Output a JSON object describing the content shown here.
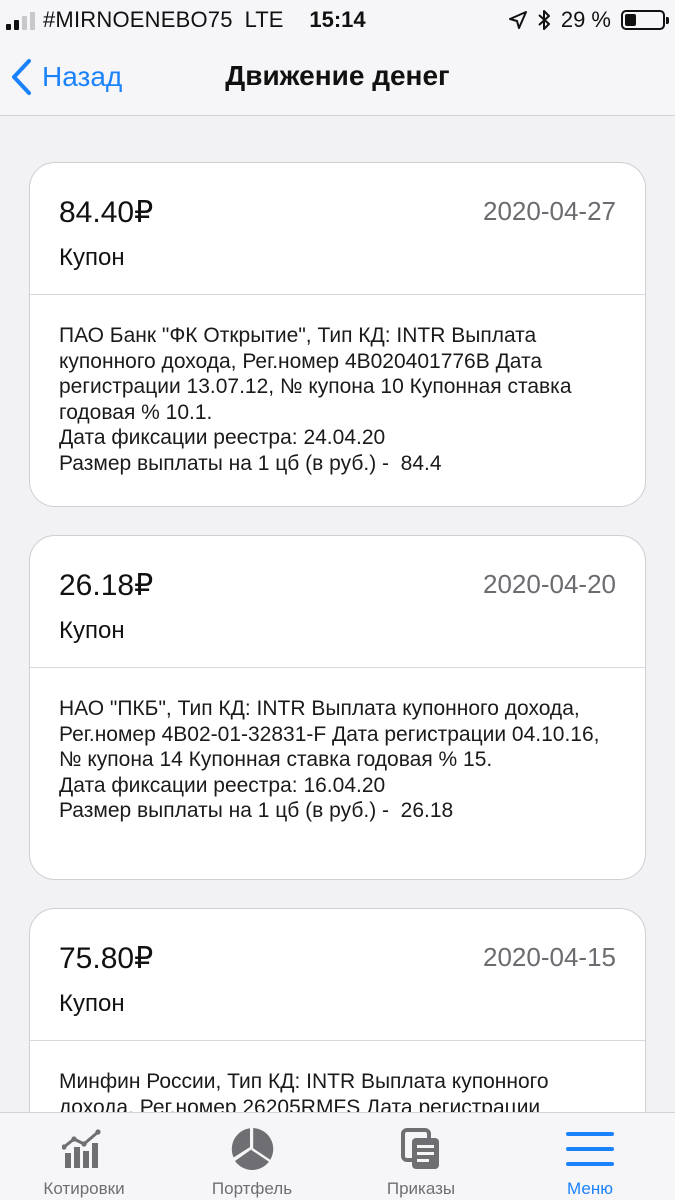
{
  "status_bar": {
    "carrier": "#MIRNOENEBO75",
    "network": "LTE",
    "time": "15:14",
    "battery": "29 %"
  },
  "nav": {
    "back_label": "Назад",
    "title": "Движение денег"
  },
  "operations": [
    {
      "amount": "84.40₽",
      "date": "2020-04-27",
      "type": "Купон",
      "description": "ПАО Банк \"ФК Открытие\", Тип КД: INTR Выплата купонного дохода, Рег.номер 4B020401776B Дата регистрации 13.07.12, № купона 10 Купонная ставка годовая % 10.1.",
      "registry_date": "Дата фиксации реестра: 24.04.20",
      "payment": "Размер выплаты на 1 цб (в руб.) -  84.4"
    },
    {
      "amount": "26.18₽",
      "date": "2020-04-20",
      "type": "Купон",
      "description": "НАО \"ПКБ\", Тип КД: INTR Выплата купонного дохода, Рег.номер 4B02-01-32831-F Дата регистрации 04.10.16, № купона 14 Купонная ставка годовая % 15.",
      "registry_date": "Дата фиксации реестра: 16.04.20",
      "payment": "Размер выплаты на 1 цб (в руб.) -  26.18"
    },
    {
      "amount": "75.80₽",
      "date": "2020-04-15",
      "type": "Купон",
      "description": "Минфин России, Тип КД: INTR Выплата купонного дохода, Рег.номер 26205RMFS Дата регистрации",
      "registry_date": "",
      "payment": ""
    }
  ],
  "tabs": [
    {
      "label": "Котировки",
      "icon": "chart-icon",
      "active": false
    },
    {
      "label": "Портфель",
      "icon": "pie-chart-icon",
      "active": false
    },
    {
      "label": "Приказы",
      "icon": "documents-icon",
      "active": false
    },
    {
      "label": "Меню",
      "icon": "menu-icon",
      "active": true
    }
  ],
  "colors": {
    "accent": "#1a82fb",
    "background": "#f2f2f4",
    "tab_inactive": "#6e6e73"
  }
}
